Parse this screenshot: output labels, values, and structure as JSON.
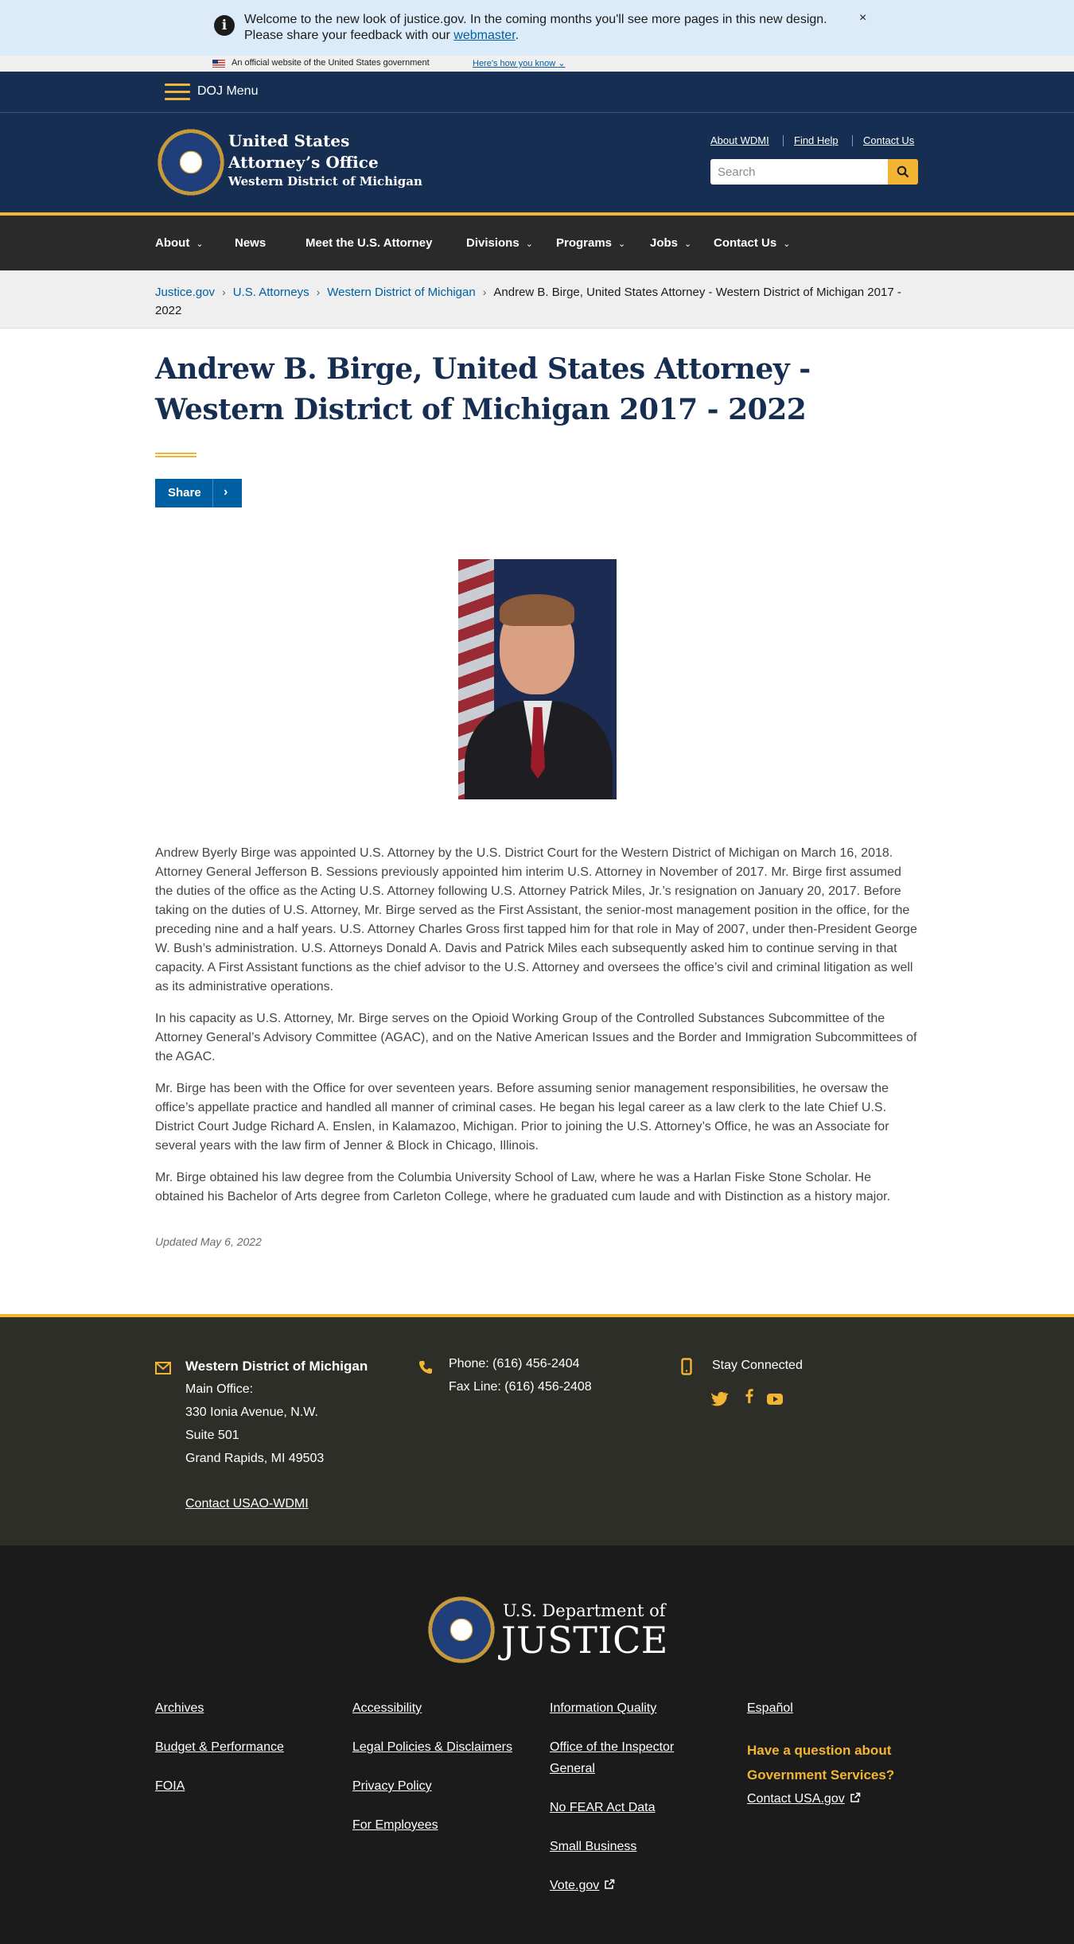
{
  "alert": {
    "text": "Welcome to the new look of justice.gov. In the coming months you'll see more pages in this new design. Please share your feedback with our ",
    "link": "webmaster",
    "end": ".",
    "close": "×"
  },
  "gov_banner": {
    "text": "An official website of the United States government",
    "link": "Here's how you know"
  },
  "doj_menu": {
    "label": "DOJ Menu"
  },
  "header": {
    "org_line1": "United States",
    "org_line2": "Attorney’s Office",
    "org_district": "Western District of Michigan",
    "utility_links": [
      "About WDMI",
      "Find Help",
      "Contact Us"
    ],
    "search_placeholder": "Search"
  },
  "main_nav": {
    "items": [
      "About",
      "News",
      "Meet the U.S. Attorney",
      "Divisions",
      "Programs",
      "Jobs",
      "Contact Us"
    ]
  },
  "breadcrumb": {
    "items": [
      "Justice.gov",
      "U.S. Attorneys",
      "Western District of Michigan"
    ],
    "current": "Andrew B. Birge, United States Attorney - Western District of Michigan 2017 - 2022"
  },
  "page": {
    "title": "Andrew B. Birge, United States Attorney - Western District of Michigan 2017 - 2022",
    "share_label": "Share",
    "paragraphs": [
      "Andrew Byerly Birge was appointed U.S. Attorney by the U.S. District Court for the Western District of Michigan on March 16, 2018. Attorney General Jefferson B. Sessions previously appointed him interim U.S. Attorney in November of 2017. Mr. Birge first assumed the duties of the office as the Acting U.S. Attorney following U.S. Attorney Patrick Miles, Jr.’s resignation on January 20, 2017. Before taking on the duties of U.S. Attorney, Mr. Birge served as the First Assistant, the senior-most management position in the office, for the preceding nine and a half years. U.S. Attorney Charles Gross first tapped him for that role in May of 2007, under then-President George W. Bush’s administration. U.S. Attorneys Donald A. Davis and Patrick Miles each subsequently asked him to continue serving in that capacity. A First Assistant functions as the chief advisor to the U.S. Attorney and oversees the office’s civil and criminal litigation as well as its administrative operations.",
      "In his capacity as U.S. Attorney, Mr. Birge serves on the Opioid Working Group of the Controlled Substances Subcommittee of the Attorney General’s Advisory Committee (AGAC), and on the Native American Issues and the Border and Immigration Subcommittees of the AGAC.",
      "Mr. Birge has been with the Office for over seventeen years. Before assuming senior management responsibilities, he oversaw the office’s appellate practice and handled all manner of criminal cases. He began his legal career as a law clerk to the late Chief U.S. District Court Judge Richard A. Enslen, in Kalamazoo, Michigan. Prior to joining the U.S. Attorney’s Office, he was an Associate for several years with the law firm of Jenner & Block in Chicago, Illinois.",
      "Mr. Birge obtained his law degree from the Columbia University School of Law, where he was a Harlan Fiske Stone Scholar. He obtained his Bachelor of Arts degree from Carleton College, where he graduated cum laude and with Distinction as a history major."
    ],
    "updated": "Updated May 6, 2022"
  },
  "contact_footer": {
    "office_name": "Western District of Michigan",
    "address": [
      "Main Office:",
      "330 Ionia Avenue, N.W.",
      "Suite 501",
      "Grand Rapids, MI 49503"
    ],
    "contact_link": "Contact USAO-WDMI",
    "phone": "Phone: (616) 456-2404",
    "fax": "Fax Line: (616) 456-2408",
    "stay_connected": "Stay Connected",
    "social": [
      "twitter-icon",
      "facebook-icon",
      "youtube-icon"
    ]
  },
  "bottom_footer": {
    "doj_line1": "U.S. Department of",
    "doj_line2": "JUSTICE",
    "col1": [
      "Archives",
      "Budget & Performance",
      "FOIA"
    ],
    "col2": [
      "Accessibility",
      "Legal Policies & Disclaimers",
      "Privacy Policy",
      "For Employees"
    ],
    "col3": [
      "Information Quality",
      "Office of the Inspector General",
      "No FEAR Act Data",
      "Small Business",
      "Vote.gov"
    ],
    "col4_link": "Español",
    "question": "Have a question about Government Services?",
    "usa_link": "Contact USA.gov"
  },
  "colors": {
    "navy": "#162e51",
    "gold": "#f1b434",
    "link_blue": "#005ea2",
    "nav_dark": "#2a2a2a",
    "footer_dark": "#1b1b1b"
  }
}
